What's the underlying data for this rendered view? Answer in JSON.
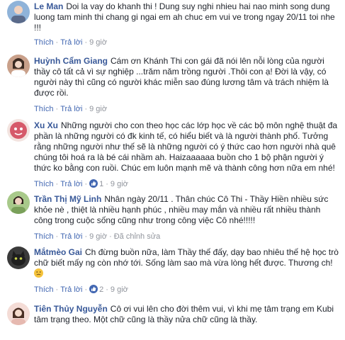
{
  "comments": [
    {
      "author": "Le Man",
      "text": "Doi la vay do khanh thi ! Dung suy nghi nhieu hai nao minh song dung luong tam minh thi chang gi ngai em ah chuc em vui ve trong ngay 20/11 toi nhe !!!",
      "like_label": "Thích",
      "reply_label": "Trả lời",
      "time": "9 giờ",
      "avatar_color": "#8fb3d9"
    },
    {
      "author": "Huỳnh Cẩm Giang",
      "text": "Cám ơn Khánh Thi con gái đã nói lên nỗi lòng của người thầy cô tất cả vì sự nghiệp ...trăm năm trồng người .Thôi con ạ! Đời là vậy, có người này thì cũng có người khác miễn sao đúng lương tâm và trách nhiệm là được rồi.",
      "like_label": "Thích",
      "reply_label": "Trả lời",
      "time": "9 giờ",
      "avatar_color": "#c9a08a"
    },
    {
      "author": "Xu Xu",
      "text": "Những người cho con theo học các lớp học về các bộ môn nghệ thuật đa phần là những người có đk kinh tế, có hiểu biết và là người thành phố. Tưởng rằng những người như thế sẽ là những người có ý thức cao hơn người nhà quê chúng tôi hoá ra là bé cái nhầm ah. Haizaaaaaa buồn cho 1 bộ phận người ý thức ko bằng con ruồi. Chúc em luôn mạnh mẽ và thành công hơn nữa em nhé!",
      "like_label": "Thích",
      "reply_label": "Trả lời",
      "likes": "1",
      "time": "9 giờ",
      "avatar_color": "#d65a6a"
    },
    {
      "author": "Trần Thị Mỹ Linh",
      "text": "Nhân ngày 20/11 . Thân chúc Cô Thi - Thầy Hiền nhiều sức khỏe nè , thiệt là nhiều hạnh phúc , nhiều may mắn và nhiều rất nhiều thành công trong cuộc sống cũng như trong công việc Cô nhé!!!!!",
      "like_label": "Thích",
      "reply_label": "Trả lời",
      "time": "9 giờ",
      "edited_label": "Đã chỉnh sửa",
      "avatar_color": "#7aa05a"
    },
    {
      "author": "Mắtmèo Gai",
      "text": "Ch đừng buồn nữa, làm Thầy thế đấy, dạy bao nhiêu thế hệ học trò chữ biết mấy ng còn nhớ tới. Sống làm sao mà vừa lòng hết được. Thương ch!",
      "like_label": "Thích",
      "reply_label": "Trả lời",
      "likes": "2",
      "time": "9 giờ",
      "avatar_color": "#3a3a3a"
    },
    {
      "author": "Tiên Thủy Nguyễn",
      "text": "Cô ơi vui lên cho đời thêm vui, vì khi mẹ tâm trạng em Kubi tâm trạng theo. Một chữ cũng là thầy nửa chữ cũng là thầy.",
      "avatar_color": "#e6b9b0"
    }
  ]
}
